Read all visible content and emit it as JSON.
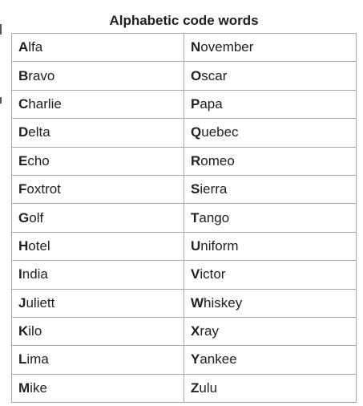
{
  "caption": "Alphabetic code words",
  "rows": [
    [
      {
        "initial": "A",
        "rest": "lfa"
      },
      {
        "initial": "N",
        "rest": "ovember"
      }
    ],
    [
      {
        "initial": "B",
        "rest": "ravo"
      },
      {
        "initial": "O",
        "rest": "scar"
      }
    ],
    [
      {
        "initial": "C",
        "rest": "harlie"
      },
      {
        "initial": "P",
        "rest": "apa"
      }
    ],
    [
      {
        "initial": "D",
        "rest": "elta"
      },
      {
        "initial": "Q",
        "rest": "uebec"
      }
    ],
    [
      {
        "initial": "E",
        "rest": "cho"
      },
      {
        "initial": "R",
        "rest": "omeo"
      }
    ],
    [
      {
        "initial": "F",
        "rest": "oxtrot"
      },
      {
        "initial": "S",
        "rest": "ierra"
      }
    ],
    [
      {
        "initial": "G",
        "rest": "olf"
      },
      {
        "initial": "T",
        "rest": "ango"
      }
    ],
    [
      {
        "initial": "H",
        "rest": "otel"
      },
      {
        "initial": "U",
        "rest": "niform"
      }
    ],
    [
      {
        "initial": "I",
        "rest": "ndia"
      },
      {
        "initial": "V",
        "rest": "ictor"
      }
    ],
    [
      {
        "initial": "J",
        "rest": "uliett"
      },
      {
        "initial": "W",
        "rest": "hiskey"
      }
    ],
    [
      {
        "initial": "K",
        "rest": "ilo"
      },
      {
        "initial": "X",
        "rest": "ray"
      }
    ],
    [
      {
        "initial": "L",
        "rest": "ima"
      },
      {
        "initial": "Y",
        "rest": "ankee"
      }
    ],
    [
      {
        "initial": "M",
        "rest": "ike"
      },
      {
        "initial": "Z",
        "rest": "ulu"
      }
    ]
  ]
}
